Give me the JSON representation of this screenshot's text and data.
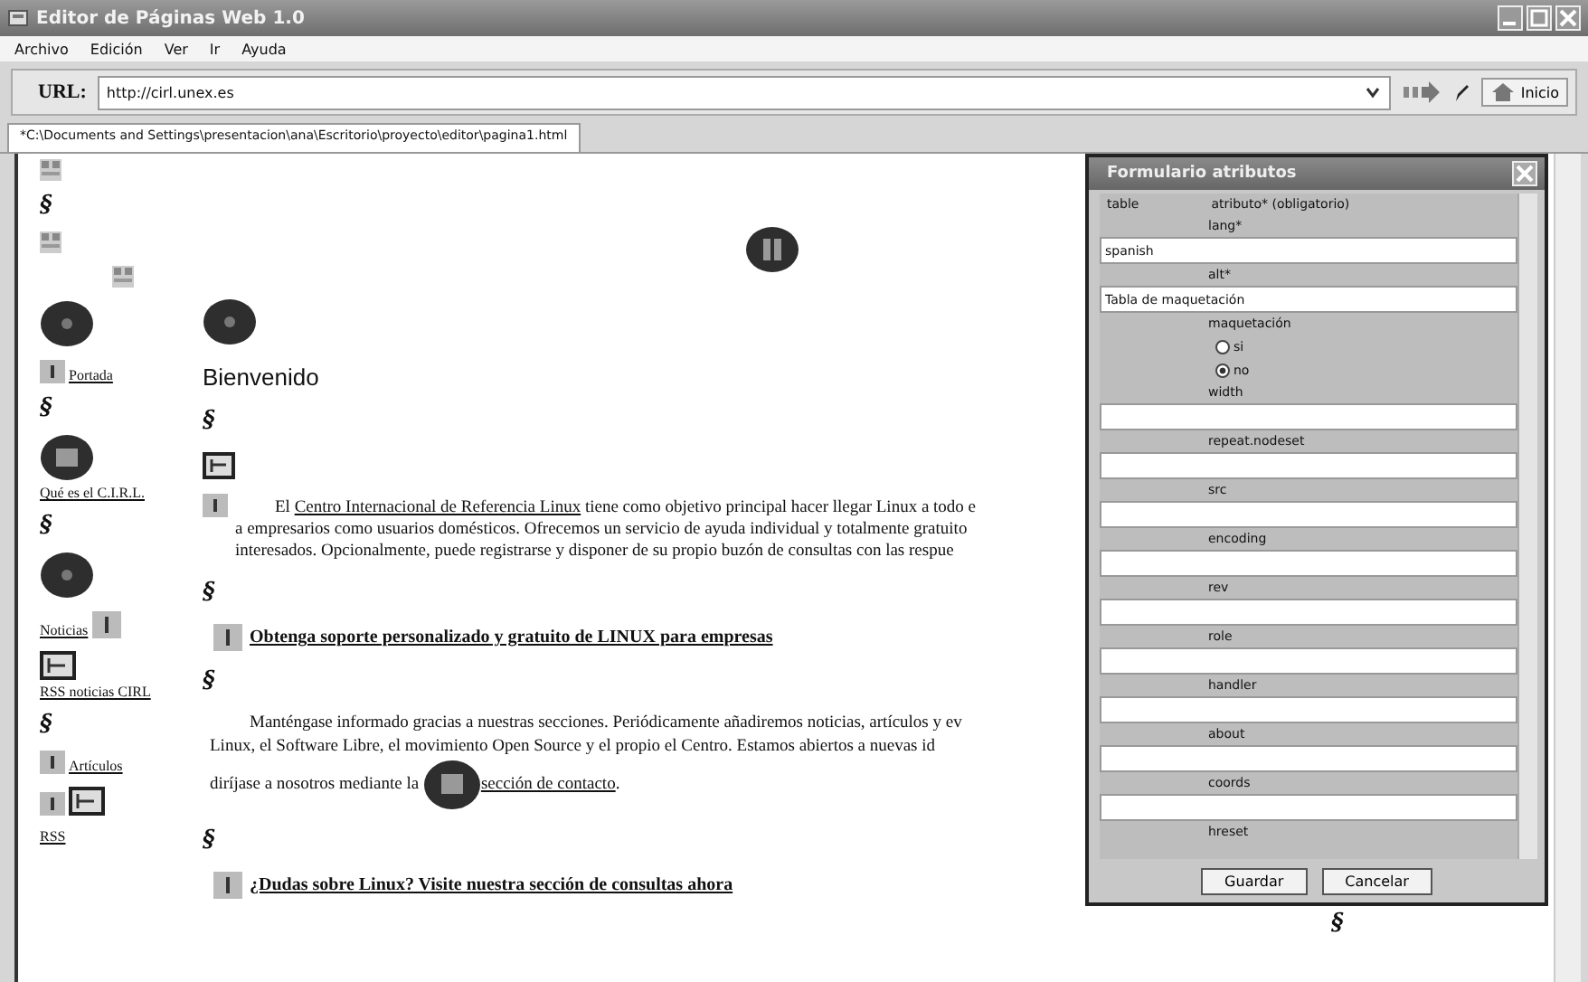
{
  "window": {
    "title": "Editor de Páginas Web 1.0"
  },
  "menu": [
    "Archivo",
    "Edición",
    "Ver",
    "Ir",
    "Ayuda"
  ],
  "url_bar": {
    "label": "URL:",
    "value": "http://cirl.unex.es",
    "home_button": "Inicio"
  },
  "document_tab": {
    "label": "*C:\\Documents and Settings\\presentacion\\ana\\Escritorio\\proyecto\\editor\\pagina1.html",
    "selected": true
  },
  "sidebar": [
    {
      "kind": "placeholder"
    },
    {
      "kind": "section",
      "text": "§"
    },
    {
      "kind": "placeholder"
    },
    {
      "kind": "placeholder_offset"
    },
    {
      "kind": "badge"
    },
    {
      "kind": "link",
      "text": "Portada"
    },
    {
      "kind": "section",
      "text": "§"
    },
    {
      "kind": "badge_link",
      "text": "Qué es el C.I.R.L."
    },
    {
      "kind": "section",
      "text": "§"
    },
    {
      "kind": "badge"
    },
    {
      "kind": "link_after",
      "text": "Noticias"
    },
    {
      "kind": "frame_link",
      "text": "RSS noticias CIRL"
    },
    {
      "kind": "section",
      "text": "§"
    },
    {
      "kind": "link",
      "text": "Artículos"
    },
    {
      "kind": "marker_frame"
    },
    {
      "kind": "plain_link",
      "text": "RSS"
    }
  ],
  "main": [
    {
      "kind": "badge_pair"
    },
    {
      "kind": "heading",
      "text": "Bienvenido"
    },
    {
      "kind": "section",
      "text": "§"
    },
    {
      "kind": "frame"
    },
    {
      "kind": "paragraph",
      "marker": true,
      "lines": [
        [
          {
            "kind": "text",
            "text": "El "
          },
          {
            "kind": "link",
            "text": "Centro Internacional de Referencia Linux"
          },
          {
            "kind": "text",
            "text": " tiene como objetivo principal hacer llegar Linux a todo e"
          }
        ],
        [
          {
            "kind": "text",
            "text": "a empresarios como usuarios domésticos. Ofrecemos un servicio de ayuda individual y totalmente gratuito"
          }
        ],
        [
          {
            "kind": "text",
            "text": "interesados. Opcionalmente, puede registrarse y disponer de su propio buzón de consultas con las respue"
          }
        ]
      ]
    },
    {
      "kind": "section",
      "text": "§"
    },
    {
      "kind": "link_heading",
      "text": "Obtenga soporte personalizado y gratuito de LINUX para empresas"
    },
    {
      "kind": "section",
      "text": "§"
    },
    {
      "kind": "paragraph",
      "marker": false,
      "lines": [
        [
          {
            "kind": "text",
            "text": "Manténgase informado gracias a nuestras secciones. Periódicamente añadiremos noticias, artículos y ev"
          }
        ],
        [
          {
            "kind": "text",
            "text": "Linux, el Software Libre, el movimiento Open Source y el propio el Centro. Estamos abiertos a nuevas id"
          }
        ],
        [
          {
            "kind": "text",
            "text": "diríjase a nosotros mediante la "
          },
          {
            "kind": "badge"
          },
          {
            "kind": "link",
            "text": "sección de contacto"
          },
          {
            "kind": "text",
            "text": "."
          }
        ]
      ]
    },
    {
      "kind": "section",
      "text": "§"
    },
    {
      "kind": "link_heading",
      "text": "¿Dudas sobre Linux? Visite nuestra sección de consultas ahora"
    }
  ],
  "footer_mark": "§",
  "dialog": {
    "title": "Formulario atributos",
    "col_1": "table",
    "col_2": "atributo* (obligatorio)",
    "fields": [
      {
        "label": "lang*",
        "kind": "text",
        "value": "spanish"
      },
      {
        "label": "alt*",
        "kind": "text",
        "value": "Tabla de maquetación"
      },
      {
        "label": "maquetación",
        "kind": "radio",
        "options": [
          {
            "label": "si",
            "selected": false
          },
          {
            "label": "no",
            "selected": true
          }
        ]
      },
      {
        "label": "width",
        "kind": "text"
      },
      {
        "label": "repeat.nodeset",
        "kind": "text"
      },
      {
        "label": "src",
        "kind": "text"
      },
      {
        "label": "encoding",
        "kind": "text"
      },
      {
        "label": "rev",
        "kind": "text"
      },
      {
        "label": "role",
        "kind": "text"
      },
      {
        "label": "handler",
        "kind": "text"
      },
      {
        "label": "about",
        "kind": "text"
      },
      {
        "label": "coords",
        "kind": "text"
      },
      {
        "label": "hreset",
        "kind": "cut"
      }
    ],
    "buttons": [
      "Guardar",
      "Cancelar"
    ]
  }
}
